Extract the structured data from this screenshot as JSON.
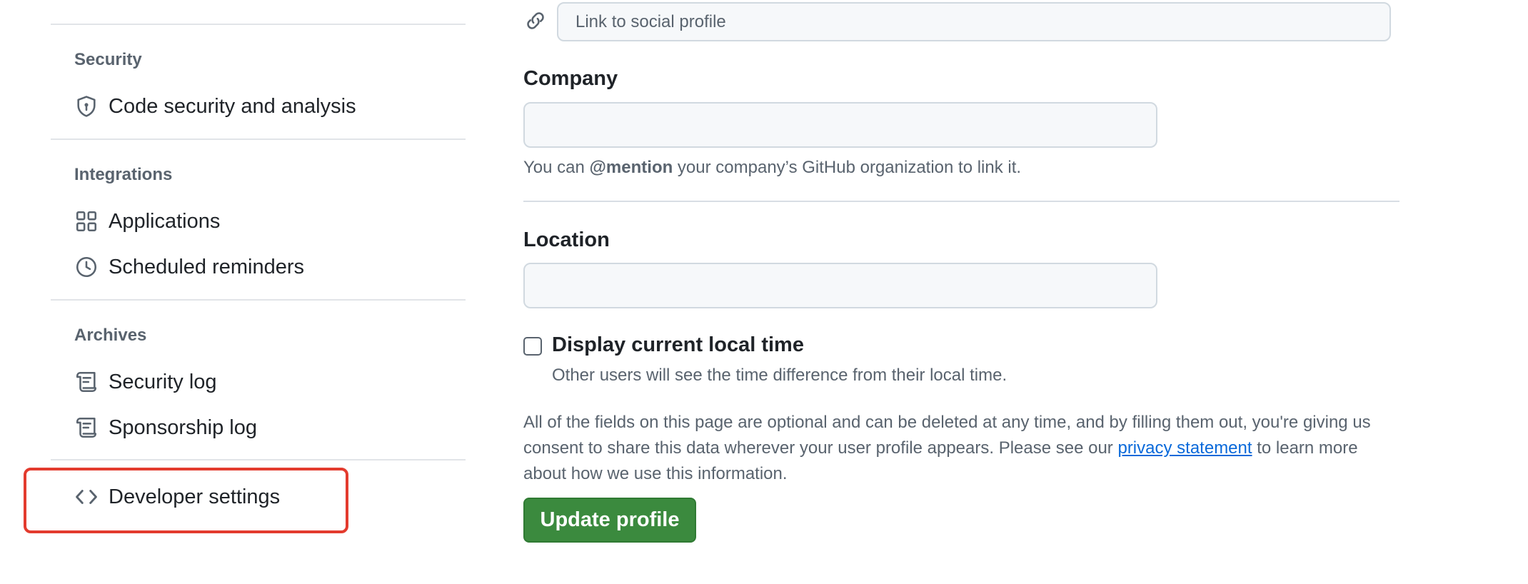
{
  "sidebar": {
    "sections": [
      {
        "title": "Security",
        "items": [
          {
            "label": "Code security and analysis",
            "icon": "shield-lock-icon"
          }
        ]
      },
      {
        "title": "Integrations",
        "items": [
          {
            "label": "Applications",
            "icon": "apps-grid-icon"
          },
          {
            "label": "Scheduled reminders",
            "icon": "clock-icon"
          }
        ]
      },
      {
        "title": "Archives",
        "items": [
          {
            "label": "Security log",
            "icon": "log-icon"
          },
          {
            "label": "Sponsorship log",
            "icon": "log-icon"
          }
        ]
      }
    ],
    "developer_settings": {
      "label": "Developer settings",
      "icon": "code-icon"
    },
    "highlight_color": "#e33b2e"
  },
  "profile_form": {
    "social_link": {
      "placeholder": "Link to social profile",
      "value": ""
    },
    "company": {
      "label": "Company",
      "value": "",
      "note_prefix": "You can ",
      "note_mention": "@mention",
      "note_suffix": " your company’s GitHub organization to link it."
    },
    "location": {
      "label": "Location",
      "value": ""
    },
    "local_time": {
      "checked": false,
      "label": "Display current local time",
      "note": "Other users will see the time difference from their local time."
    },
    "consent": {
      "text_before": "All of the fields on this page are optional and can be deleted at any time, and by filling them out, you're giving us consent to share this data wherever your user profile appears. Please see our ",
      "link_text": "privacy statement",
      "text_after": " to learn more about how we use this information."
    },
    "update_button": {
      "label": "Update profile",
      "color": "#3b8a3e"
    }
  }
}
